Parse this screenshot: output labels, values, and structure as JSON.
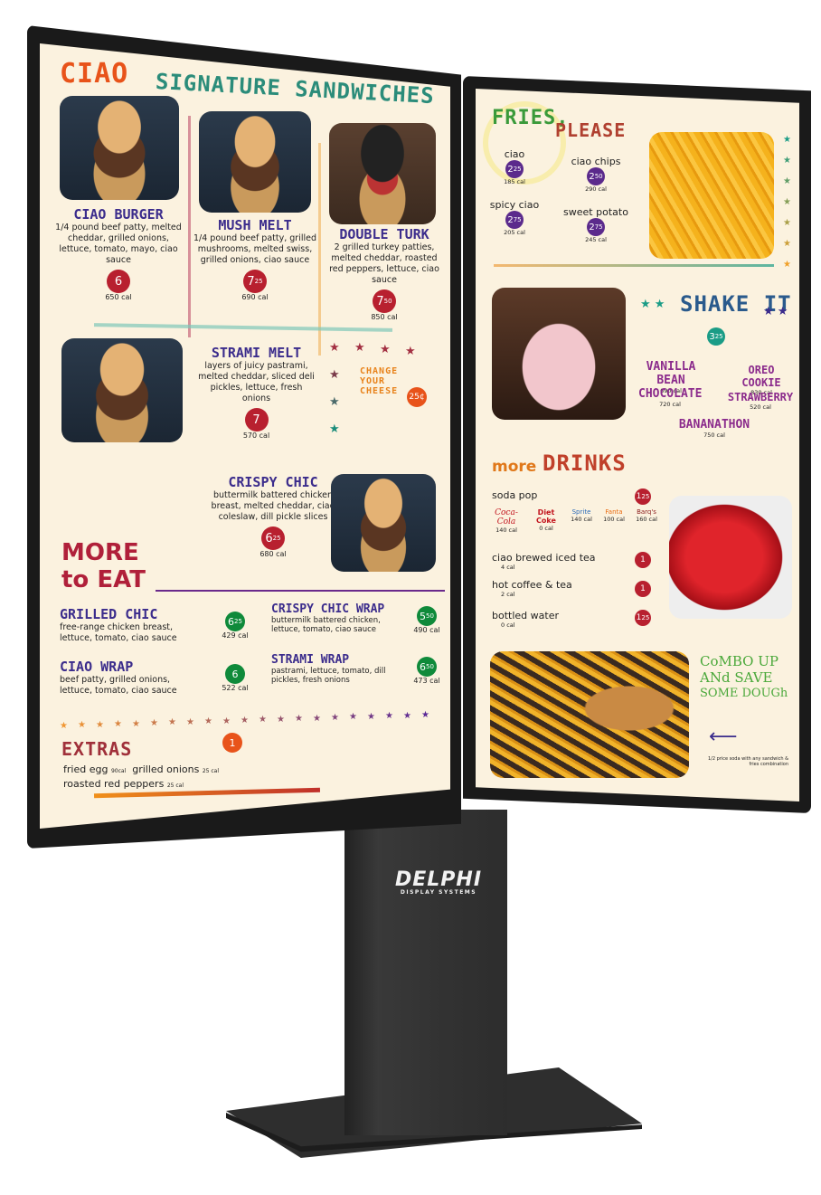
{
  "brand": {
    "logo_main": "DELPHI",
    "logo_sub": "DISPLAY SYSTEMS"
  },
  "left_screen": {
    "header": {
      "ciao": "CIAO",
      "title": "SIGNATURE SANDWICHES"
    },
    "sandwiches": [
      {
        "name": "CIAO BURGER",
        "desc": "1/4 pound beef patty, melted cheddar, grilled onions, lettuce, tomato, mayo, ciao sauce",
        "price_main": "6",
        "price_cents": "",
        "cal": "650 cal"
      },
      {
        "name": "MUSH MELT",
        "desc": "1/4 pound beef patty, grilled mushrooms, melted swiss, grilled onions, ciao sauce",
        "price_main": "7",
        "price_cents": "25",
        "cal": "690 cal"
      },
      {
        "name": "DOUBLE TURK",
        "desc": "2 grilled turkey patties, melted cheddar, roasted red peppers, lettuce, ciao sauce",
        "price_main": "7",
        "price_cents": "50",
        "cal": "850 cal"
      },
      {
        "name": "STRAMI MELT",
        "desc": "layers of juicy pastrami, melted cheddar, sliced deli pickles, lettuce, fresh onions",
        "price_main": "7",
        "price_cents": "",
        "cal": "570 cal"
      },
      {
        "name": "CRISPY CHIC",
        "desc": "buttermilk battered chicken breast, melted cheddar, ciao coleslaw, dill pickle slices",
        "price_main": "6",
        "price_cents": "25",
        "cal": "680 cal"
      }
    ],
    "change_cheese": {
      "label": "CHANGE YOUR CHEESE",
      "price": "25¢"
    },
    "more_to_eat": {
      "title_line1": "MORE",
      "title_line2": "to EAT",
      "items": [
        {
          "name": "GRILLED CHIC",
          "desc": "free-range chicken breast, lettuce, tomato, ciao sauce",
          "price_main": "6",
          "price_cents": "25",
          "cal": "429 cal"
        },
        {
          "name": "CIAO WRAP",
          "desc": "beef patty, grilled onions, lettuce, tomato, ciao sauce",
          "price_main": "6",
          "price_cents": "",
          "cal": "522 cal"
        },
        {
          "name": "CRISPY CHIC WRAP",
          "desc": "buttermilk battered chicken, lettuce, tomato, ciao sauce",
          "price_main": "5",
          "price_cents": "50",
          "cal": "490 cal"
        },
        {
          "name": "STRAMI WRAP",
          "desc": "pastrami, lettuce, tomato, dill pickles, fresh onions",
          "price_main": "6",
          "price_cents": "50",
          "cal": "473 cal"
        }
      ]
    },
    "extras": {
      "title": "EXTRAS",
      "price": "1",
      "items": [
        {
          "name": "fried egg",
          "cal": "90cal"
        },
        {
          "name": "grilled onions",
          "cal": "25 cal"
        },
        {
          "name": "roasted red peppers",
          "cal": "25 cal"
        }
      ]
    }
  },
  "right_screen": {
    "fries": {
      "title_a": "FRIES,",
      "title_b": "PLEASE",
      "items": [
        {
          "name": "ciao",
          "price_main": "2",
          "price_cents": "25",
          "cal": "185 cal"
        },
        {
          "name": "ciao chips",
          "price_main": "2",
          "price_cents": "50",
          "cal": "290 cal"
        },
        {
          "name": "spicy ciao",
          "price_main": "2",
          "price_cents": "75",
          "cal": "205 cal"
        },
        {
          "name": "sweet potato",
          "price_main": "2",
          "price_cents": "75",
          "cal": "245 cal"
        }
      ]
    },
    "shakes": {
      "title": "SHAKE IT",
      "price_main": "3",
      "price_cents": "25",
      "items": [
        {
          "name": "VANILLA BEAN",
          "cal": "690 cal"
        },
        {
          "name": "OREO COOKIE",
          "cal": "830 cal"
        },
        {
          "name": "CHOCOLATE",
          "cal": "720 cal"
        },
        {
          "name": "STRAWBERRY",
          "cal": "520 cal"
        },
        {
          "name": "BANANATHON",
          "cal": "750 cal"
        }
      ]
    },
    "drinks": {
      "title_a": "more",
      "title_b": "DRINKS",
      "soda": {
        "label": "soda pop",
        "price_main": "1",
        "price_cents": "25",
        "brands": [
          {
            "name": "Coca-Cola",
            "cal": "140 cal"
          },
          {
            "name": "Diet Coke",
            "cal": "0 cal"
          },
          {
            "name": "Sprite",
            "cal": "140 cal"
          },
          {
            "name": "Fanta",
            "cal": "100 cal"
          },
          {
            "name": "Barq's",
            "cal": "160 cal"
          }
        ]
      },
      "items": [
        {
          "name": "ciao brewed iced tea",
          "cal": "4 cal",
          "price_main": "1",
          "price_cents": ""
        },
        {
          "name": "hot coffee & tea",
          "cal": "2 cal",
          "price_main": "1",
          "price_cents": ""
        },
        {
          "name": "bottled water",
          "cal": "0 cal",
          "price_main": "1",
          "price_cents": "25"
        }
      ]
    },
    "combo": {
      "line1": "CoMBO UP",
      "line2": "ANd SAVE",
      "line3": "SOME DOUGh",
      "note": "1/2 price soda with any sandwich & fries combination"
    }
  },
  "colors": {
    "screen_bg": "#fbf2df",
    "name_blue": "#3b2c8c",
    "price_red": "#b8202f",
    "price_green": "#0f8a3a",
    "price_purple": "#5b2a8c",
    "teal": "#1a9c86",
    "orange": "#e8531a",
    "bezel": "#1a1a1a"
  }
}
